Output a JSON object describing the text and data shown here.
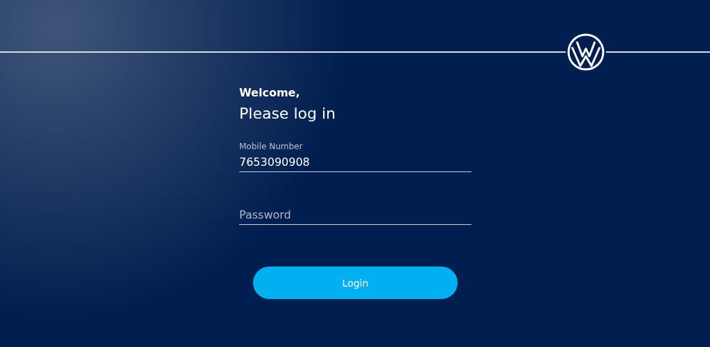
{
  "greeting": "Welcome,",
  "title": "Please log in",
  "fields": [
    {
      "kind": "filled",
      "label": "Mobile Number",
      "value": "7653090908"
    },
    {
      "kind": "empty",
      "placeholder": "Password"
    }
  ],
  "button": "Login"
}
